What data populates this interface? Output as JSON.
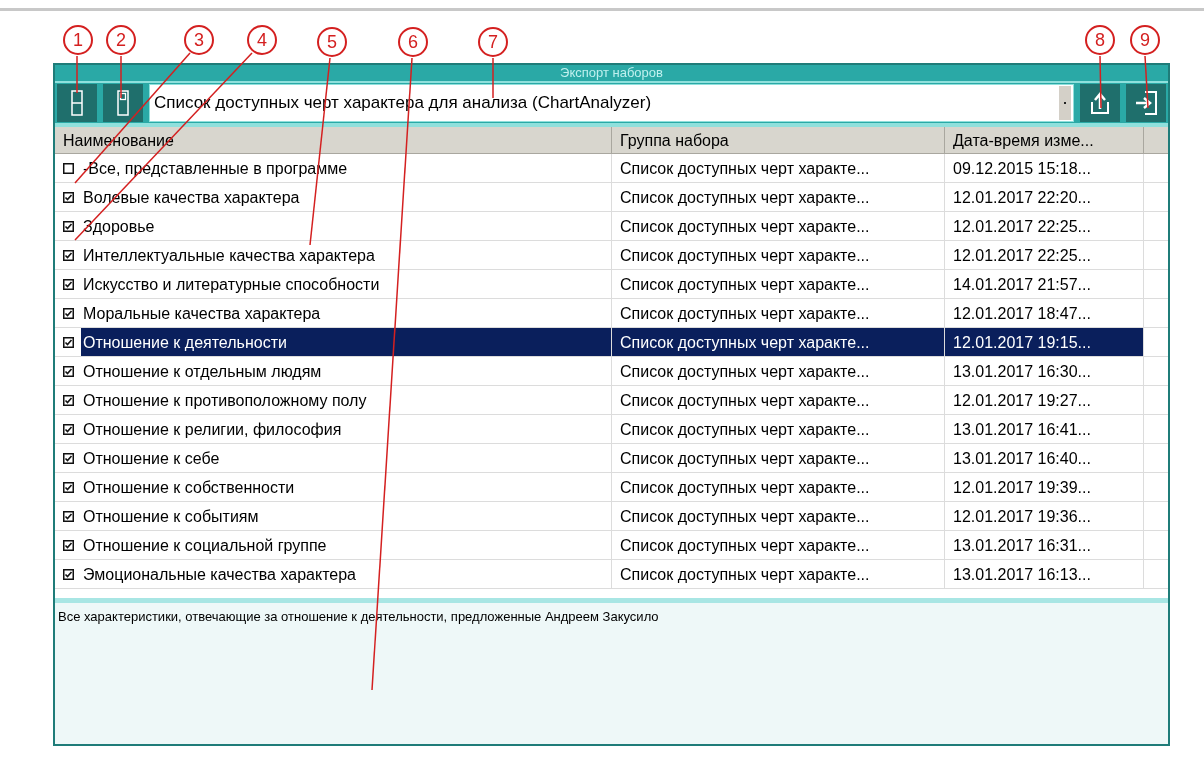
{
  "window": {
    "title": "Экспорт наборов"
  },
  "toolbar": {
    "set_selector": {
      "value": "Список доступных черт характера для анализа (ChartAnalyzer)"
    }
  },
  "table": {
    "columns": [
      "Наименование",
      "Группа набора",
      "Дата-время изме..."
    ],
    "rows": [
      {
        "checked": false,
        "selected": false,
        "name": "-Все, представленные в программе",
        "group": "Список доступных черт характе...",
        "date": "09.12.2015 15:18..."
      },
      {
        "checked": true,
        "selected": false,
        "name": "Волевые качества характера",
        "group": "Список доступных черт характе...",
        "date": "12.01.2017 22:20..."
      },
      {
        "checked": true,
        "selected": false,
        "name": "Здоровье",
        "group": "Список доступных черт характе...",
        "date": "12.01.2017 22:25..."
      },
      {
        "checked": true,
        "selected": false,
        "name": "Интеллектуальные качества характера",
        "group": "Список доступных черт характе...",
        "date": "12.01.2017 22:25..."
      },
      {
        "checked": true,
        "selected": false,
        "name": "Искусство и литературные способности",
        "group": "Список доступных черт характе...",
        "date": "14.01.2017 21:57..."
      },
      {
        "checked": true,
        "selected": false,
        "name": "Моральные качества характера",
        "group": "Список доступных черт характе...",
        "date": "12.01.2017 18:47..."
      },
      {
        "checked": true,
        "selected": true,
        "name": "Отношение к деятельности",
        "group": "Список доступных черт характе...",
        "date": "12.01.2017 19:15..."
      },
      {
        "checked": true,
        "selected": false,
        "name": "Отношение к отдельным людям",
        "group": "Список доступных черт характе...",
        "date": "13.01.2017 16:30..."
      },
      {
        "checked": true,
        "selected": false,
        "name": "Отношение к противоположному полу",
        "group": "Список доступных черт характе...",
        "date": "12.01.2017 19:27..."
      },
      {
        "checked": true,
        "selected": false,
        "name": "Отношение к религии, философия",
        "group": "Список доступных черт характе...",
        "date": "13.01.2017 16:41..."
      },
      {
        "checked": true,
        "selected": false,
        "name": "Отношение к себе",
        "group": "Список доступных черт характе...",
        "date": "13.01.2017 16:40..."
      },
      {
        "checked": true,
        "selected": false,
        "name": "Отношение к собственности",
        "group": "Список доступных черт характе...",
        "date": "12.01.2017 19:39..."
      },
      {
        "checked": true,
        "selected": false,
        "name": "Отношение к событиям",
        "group": "Список доступных черт характе...",
        "date": "12.01.2017 19:36..."
      },
      {
        "checked": true,
        "selected": false,
        "name": "Отношение к социальной группе",
        "group": "Список доступных черт характе...",
        "date": "13.01.2017 16:31..."
      },
      {
        "checked": true,
        "selected": false,
        "name": "Эмоциональные качества характера",
        "group": "Список доступных черт характе...",
        "date": "13.01.2017 16:13..."
      }
    ]
  },
  "description": "Все характеристики, отвечающие за отношение к деятельности, предложенные Андреем Закусило",
  "callouts": [
    "1",
    "2",
    "3",
    "4",
    "5",
    "6",
    "7",
    "8",
    "9"
  ]
}
